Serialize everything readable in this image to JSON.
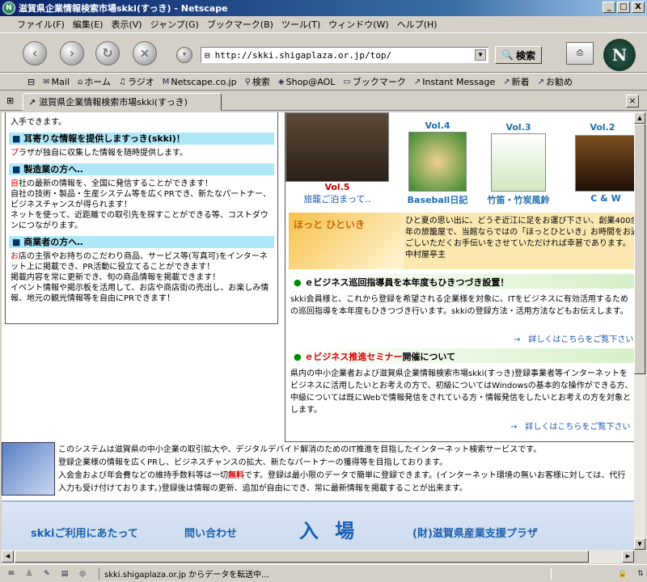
{
  "window": {
    "title": "滋賀県企業情報検索市場skki(すっき) - Netscape",
    "minimize": "_",
    "maximize": "□",
    "close": "X"
  },
  "menu": [
    "ファイル(F)",
    "編集(E)",
    "表示(V)",
    "ジャンプ(G)",
    "ブックマーク(B)",
    "ツール(T)",
    "ウィンドウ(W)",
    "ヘルプ(H)"
  ],
  "nav": {
    "url": "http://skki.shigaplaza.or.jp/top/",
    "search_label": "検索",
    "logo": "N"
  },
  "bookmarks": [
    "Mail",
    "ホーム",
    "ラジオ",
    "Netscape.co.jp",
    "検索",
    "Shop@AOL",
    "ブックマーク",
    "Instant Message",
    "新着",
    "お勧め"
  ],
  "tab": {
    "title": "滋賀県企業情報検索市場skki(すっき)"
  },
  "left": {
    "top_text": "入手できます。",
    "sections": [
      {
        "title": "耳寄りな情報を提供しますっき(skki)！",
        "lead": "プ",
        "text": "ラザが独自に収集した情報を随時提供します。"
      },
      {
        "title": "製造業の方へ‥",
        "lead": "自",
        "text": "社の最新の情報を、全国に発信することができます！\n自社の技術・製品・生産システム等を広くPRでき、新たなパートナー、ビジネスチャンスが得られます！\nネットを使って、近距離での取引先を探すことができる等、コストダウンにつながります。"
      },
      {
        "title": "商業者の方へ‥",
        "lead": "お",
        "text": "店の主張やお持ちのこだわり商品、サービス等(写真可)をインターネット上に掲載でき、PR活動に役立てることができます！\n掲載内容を常に更新でき、旬の商品情報を掲載できます！\nイベント情報や掲示板を活用して、お店や商店街の売出し、お楽しみ情報、地元の観光情報等を自由にPRできます！"
      }
    ]
  },
  "right": {
    "vols": [
      {
        "vol": "Vol.5",
        "caption": "旅籠ご泊まって‥"
      },
      {
        "vol": "Vol.4",
        "caption": "Baseball日記"
      },
      {
        "vol": "Vol.3",
        "caption": "竹笛・竹炭風鈴"
      },
      {
        "vol": "Vol.2",
        "caption": "C & W"
      }
    ],
    "hotto_logo": "ほっと ひといき",
    "hotto_text": "ひと夏の思い出に、どうぞ近江に足をお運び下さい、創業400余年の旅籠屋で、当館ならではの「ほっとひといき」お時間をお過ごしいただくお手伝いをさせていただければ幸甚であります。　中村屋亭主",
    "news1": {
      "title": "ｅビジネス巡回指導員を本年度もひきつづき設置！",
      "body": "skki会員様と、これから登録を希望される企業様を対象に、ITをビジネスに有効活用するための巡回指導を本年度もひきつづき行います。skkiの登録方法・活用方法などもお伝えします。",
      "more": "→　詳しくはこちらをご覧下さい"
    },
    "news2": {
      "title_red": "ｅビジネス推進セミナー",
      "title_rest": "開催について",
      "body": "県内の中小企業者および滋賀県企業情報検索市場skki(すっき)登録事業者等インターネットをビジネスに活用したいとお考えの方で、初級についてはWindowsの基本的な操作ができる方、中級については既にWebで情報発信をされている方・情報発信をしたいとお考えの方を対象とします。",
      "more": "→　詳しくはこちらをご覧下さい"
    }
  },
  "footer": {
    "line1": "このシステムは滋賀県の中小企業の取引拡大や、デジタルデバイド解消のためのIT推進を目指したインターネット検索サービスです。",
    "line2": "登録企業様の情報を広くPRし、ビジネスチャンスの拡大、新たなパートナーの獲得等を目指しております。",
    "line3a": "入会金および年会費などの維持手数料等は一切",
    "line3b": "無料",
    "line3c": "です。登録は最小限のデータで簡単に登録できます。(インターネット環境の無いお客様に対しては、代行入力も受け付けております。)登録後は情報の更新、追加が自由にでき、常に最新情報を掲載することが出来ます。"
  },
  "bottom_nav": {
    "usage": "skkiご利用にあたって",
    "contact": "問い合わせ",
    "enter": "入 場",
    "org": "(財)滋賀県産業支援プラザ"
  },
  "status": {
    "text": "skki.shigaplaza.or.jp からデータを転送中..."
  }
}
